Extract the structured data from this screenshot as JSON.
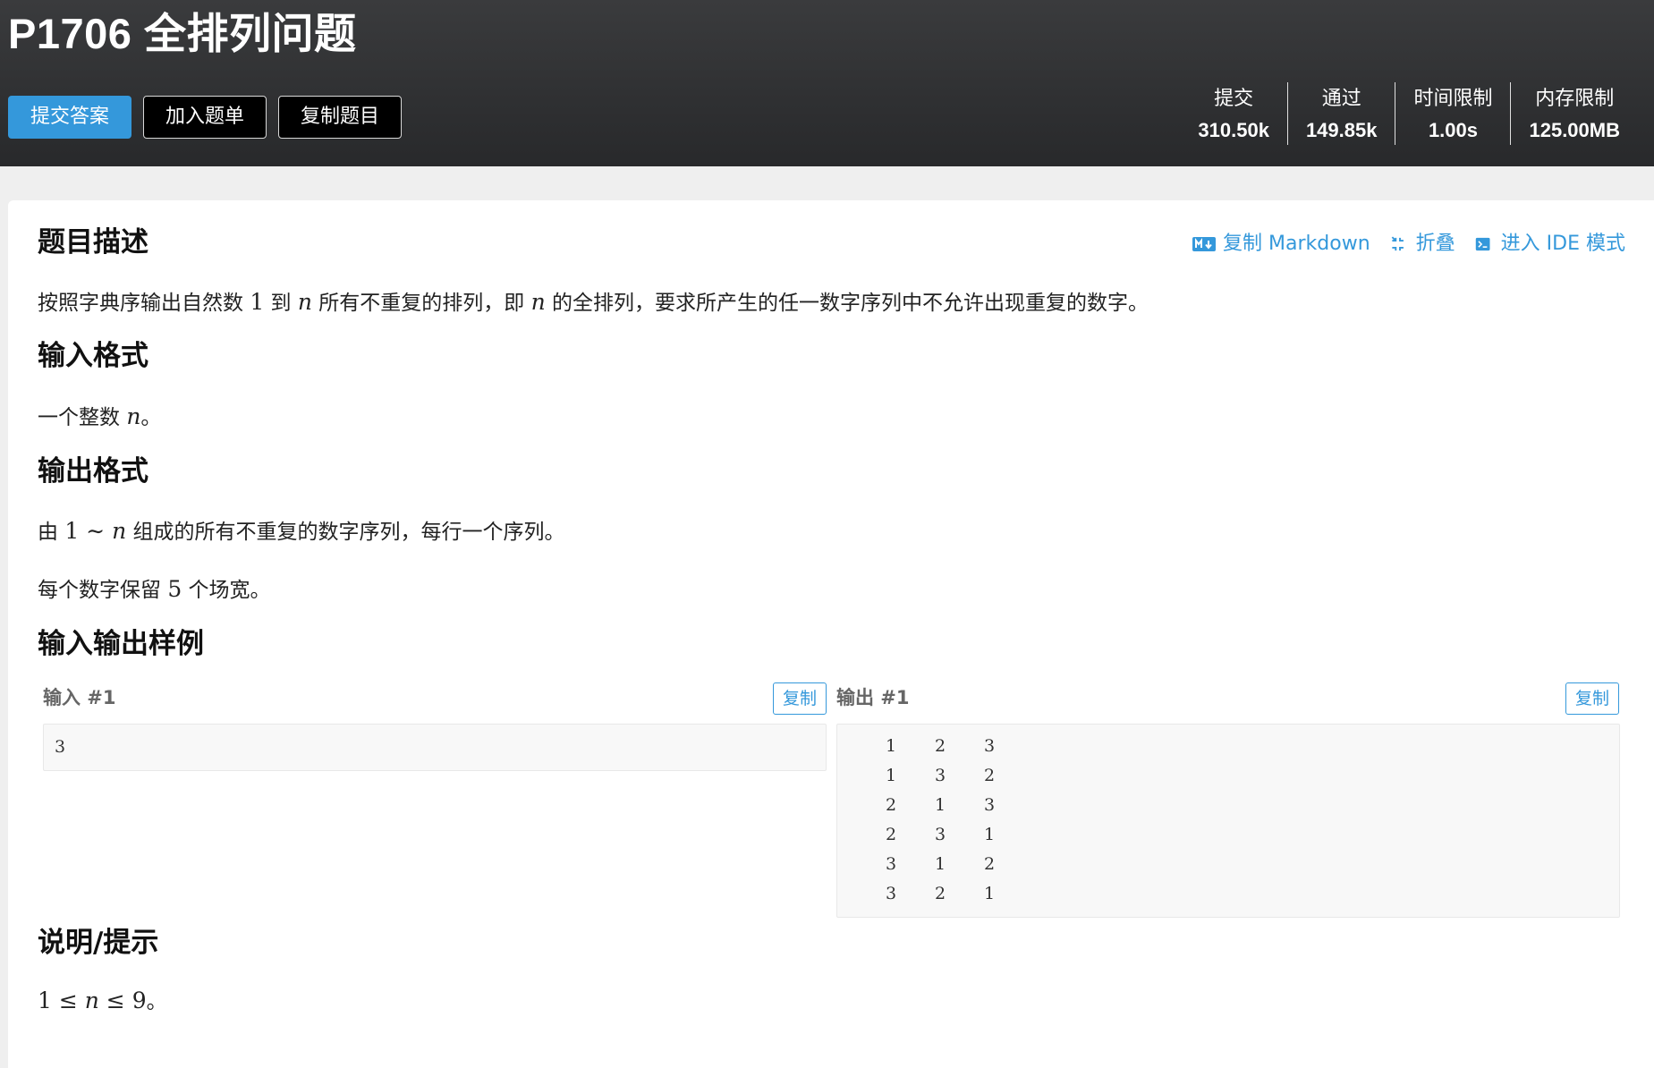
{
  "header": {
    "title": "P1706 全排列问题",
    "buttons": {
      "submit": "提交答案",
      "add_to_list": "加入题单",
      "copy_problem": "复制题目"
    },
    "stats": [
      {
        "label": "提交",
        "value": "310.50k"
      },
      {
        "label": "通过",
        "value": "149.85k"
      },
      {
        "label": "时间限制",
        "value": "1.00s"
      },
      {
        "label": "内存限制",
        "value": "125.00MB"
      }
    ]
  },
  "actions": {
    "copy_markdown": "复制 Markdown",
    "fold": "折叠",
    "ide_mode": "进入 IDE 模式"
  },
  "sections": {
    "description": {
      "title": "题目描述",
      "t1": "按照字典序输出自然数 ",
      "m1": "1",
      "t2": " 到 ",
      "m2": "n",
      "t3": " 所有不重复的排列，即 ",
      "m3": "n",
      "t4": " 的全排列，要求所产生的任一数字序列中不允许出现重复的数字。"
    },
    "input_format": {
      "title": "输入格式",
      "t1": "一个整数 ",
      "m1": "n",
      "t2": "。"
    },
    "output_format": {
      "title": "输出格式",
      "p1_t1": "由 ",
      "p1_m1": "1 ∼ ",
      "p1_m2": "n",
      "p1_t2": " 组成的所有不重复的数字序列，每行一个序列。",
      "p2_t1": "每个数字保留 ",
      "p2_m1": "5",
      "p2_t2": " 个场宽。"
    },
    "samples": {
      "title": "输入输出样例",
      "input_label": "输入 #1",
      "output_label": "输出 #1",
      "copy_label": "复制",
      "input_text": "3",
      "output_rows": [
        [
          "1",
          "2",
          "3"
        ],
        [
          "1",
          "3",
          "2"
        ],
        [
          "2",
          "1",
          "3"
        ],
        [
          "2",
          "3",
          "1"
        ],
        [
          "3",
          "1",
          "2"
        ],
        [
          "3",
          "2",
          "1"
        ]
      ]
    },
    "hint": {
      "title": "说明/提示",
      "m_a": "1 ≤ ",
      "m_b": "n",
      "m_c": " ≤ 9",
      "t_end": "。"
    }
  },
  "colors": {
    "header_bg": "#2f3032",
    "accent": "#3498db",
    "page_bg": "#efefef"
  }
}
